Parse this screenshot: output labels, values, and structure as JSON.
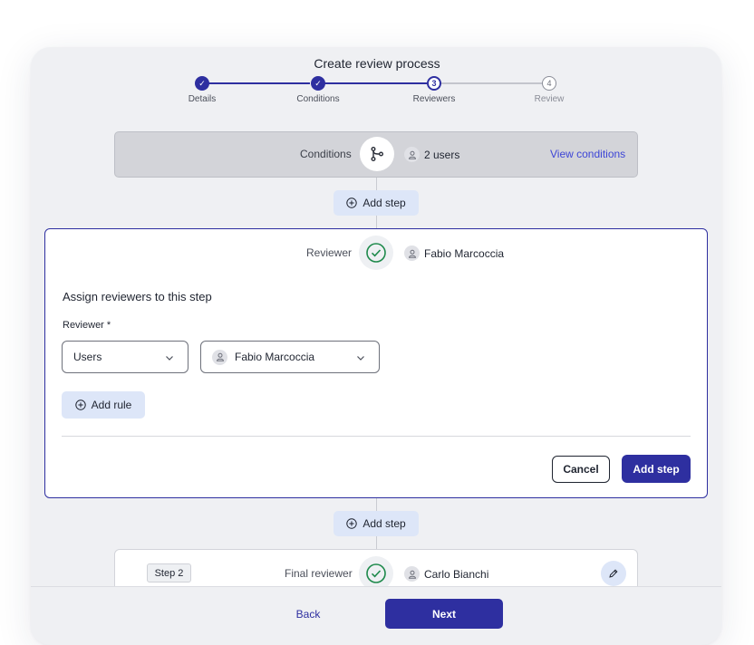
{
  "title": "Create review process",
  "stepper": {
    "steps": [
      {
        "label": "Details",
        "state": "done",
        "marker": "✓"
      },
      {
        "label": "Conditions",
        "state": "done",
        "marker": "✓"
      },
      {
        "label": "Reviewers",
        "state": "current",
        "marker": "3"
      },
      {
        "label": "Review",
        "state": "todo",
        "marker": "4"
      }
    ]
  },
  "conditions": {
    "label": "Conditions",
    "icon": "branch-icon",
    "users": "2 users",
    "link": "View conditions"
  },
  "add_step_label": "Add step",
  "editor": {
    "reviewer_label": "Reviewer",
    "reviewer_name": "Fabio Marcoccia",
    "heading": "Assign reviewers to this step",
    "field_label": "Reviewer *",
    "type_select": "Users",
    "person_select": "Fabio Marcoccia",
    "add_rule": "Add rule",
    "cancel": "Cancel",
    "submit": "Add step"
  },
  "step2": {
    "badge": "Step 2",
    "label": "Final reviewer",
    "name": "Carlo Bianchi"
  },
  "footer": {
    "back": "Back",
    "next": "Next"
  },
  "colors": {
    "accent": "#2e2fa0",
    "link": "#3d45d6",
    "success": "#1f8a4c",
    "pill": "#dde6f8"
  }
}
